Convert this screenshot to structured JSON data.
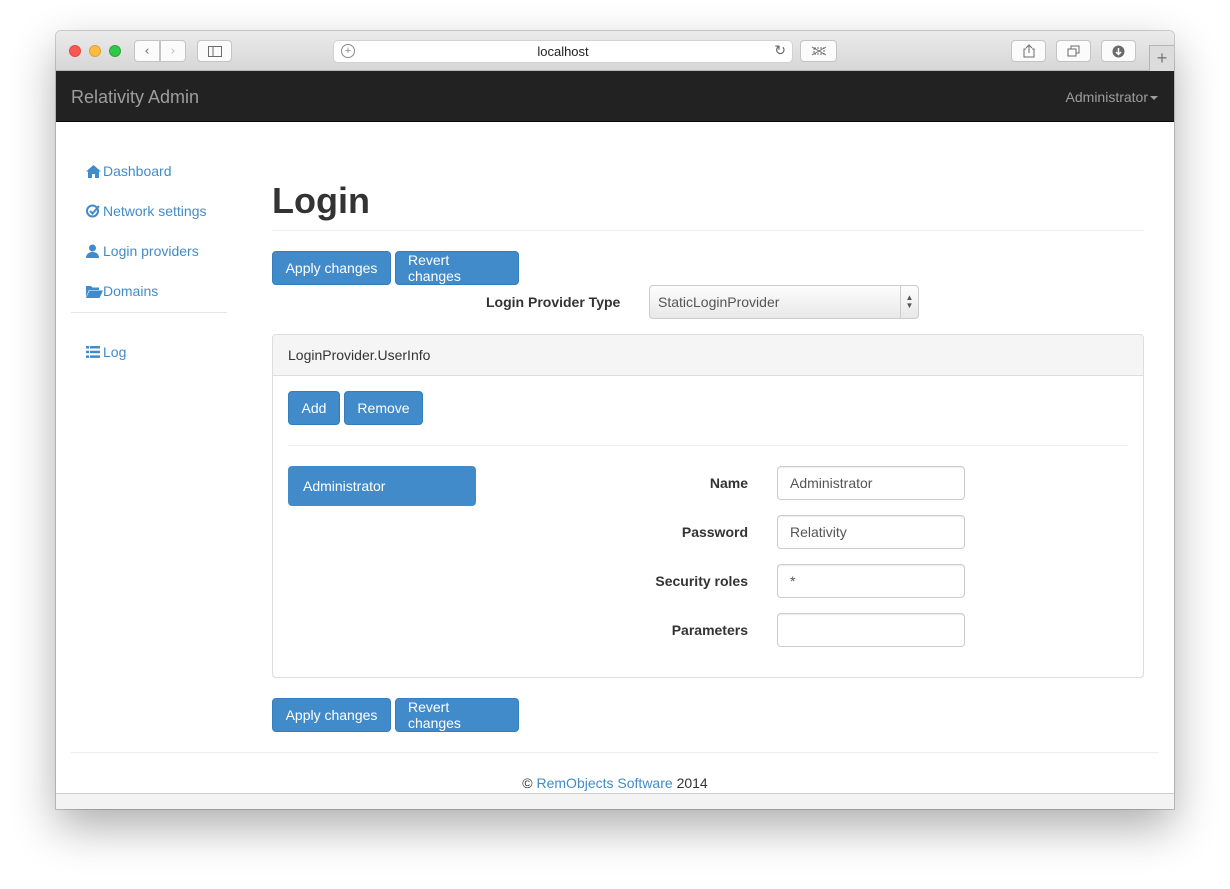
{
  "browser": {
    "url": "localhost"
  },
  "navbar": {
    "brand": "Relativity Admin",
    "user": "Administrator"
  },
  "sidebar": {
    "items": [
      {
        "label": "Dashboard",
        "icon": "home-icon"
      },
      {
        "label": "Network settings",
        "icon": "check-circle-icon"
      },
      {
        "label": "Login providers",
        "icon": "user-icon"
      },
      {
        "label": "Domains",
        "icon": "folder-open-icon"
      }
    ],
    "log": {
      "label": "Log",
      "icon": "list-icon"
    }
  },
  "main": {
    "title": "Login",
    "apply_label": "Apply changes",
    "revert_label": "Revert changes",
    "provider_type_label": "Login Provider Type",
    "provider_type_value": "StaticLoginProvider",
    "panel": {
      "heading": "LoginProvider.UserInfo",
      "add_label": "Add",
      "remove_label": "Remove",
      "users": [
        "Administrator"
      ],
      "fields": {
        "name_label": "Name",
        "name_value": "Administrator",
        "password_label": "Password",
        "password_value": "Relativity",
        "roles_label": "Security roles",
        "roles_value": "*",
        "params_label": "Parameters",
        "params_value": ""
      }
    }
  },
  "footer": {
    "copyright": "©",
    "company": "RemObjects Software",
    "year": "2014"
  },
  "colors": {
    "primary": "#428bca",
    "navbar": "#222222",
    "navbar_text": "#9d9d9d"
  }
}
